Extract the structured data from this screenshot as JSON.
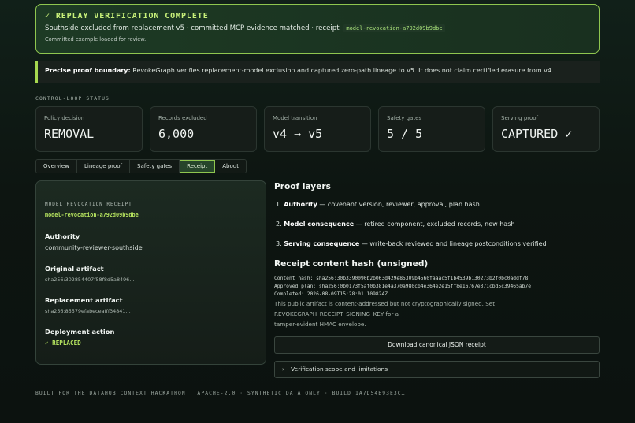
{
  "banner": {
    "title": "✓ REPLAY VERIFICATION COMPLETE",
    "subtitle": "Southside excluded from replacement v5 · committed MCP evidence matched · receipt",
    "receipt_id": "model-revocation-a792d09b9dbe",
    "note": "Committed example loaded for review."
  },
  "boundary": {
    "label": "Precise proof boundary:",
    "text": "RevokeGraph verifies replacement-model exclusion and captured zero-path lineage to v5. It does not claim certified erasure from v4."
  },
  "control_loop": {
    "label": "CONTROL-LOOP STATUS",
    "metrics": [
      {
        "label": "Policy decision",
        "value": "REMOVAL"
      },
      {
        "label": "Records excluded",
        "value": "6,000"
      },
      {
        "label": "Model transition",
        "value": "v4 → v5"
      },
      {
        "label": "Safety gates",
        "value": "5 / 5"
      },
      {
        "label": "Serving proof",
        "value": "CAPTURED ✓"
      }
    ]
  },
  "tabs": [
    "Overview",
    "Lineage proof",
    "Safety gates",
    "Receipt",
    "About"
  ],
  "active_tab": "Receipt",
  "receipt": {
    "label": "MODEL REVOCATION RECEIPT",
    "id": "model-revocation-a792d09b9dbe",
    "fields": [
      {
        "label": "Authority",
        "value": "community-reviewer-southside"
      },
      {
        "label": "Original artifact",
        "value": "sha256:302854407f58f8d5a8496…"
      },
      {
        "label": "Replacement artifact",
        "value": "sha256:85579efabeceafff34841…"
      },
      {
        "label": "Deployment action",
        "value": "✓ REPLACED"
      }
    ]
  },
  "proof_layers": {
    "title": "Proof layers",
    "items": [
      {
        "num": "1.",
        "name": "Authority",
        "desc": "— covenant version, reviewer, approval, plan hash"
      },
      {
        "num": "2.",
        "name": "Model consequence",
        "desc": "— retired component, excluded records, new hash"
      },
      {
        "num": "3.",
        "name": "Serving consequence",
        "desc": "— write-back reviewed and lineage postconditions verified"
      }
    ]
  },
  "content_hash": {
    "title": "Receipt content hash (unsigned)",
    "lines": [
      "Content hash: sha256:30b3390090b2b063d429e85309b4560faaac5f1b4539b130273b2f0bc0addf78",
      "Approved plan: sha256:0b0173f5af0b381e4a370a980cb4e364e2e15ff8e16767e371cbd5c39465ab7e",
      "Completed: 2026-08-09T15:28:01.109824Z"
    ],
    "note_1": "This public artifact is content-addressed but not cryptographically signed. Set REVOKEGRAPH_RECEIPT_SIGNING_KEY for a",
    "note_2": "tamper-evident HMAC envelope."
  },
  "download_label": "Download canonical JSON receipt",
  "details_label": "Verification scope and limitations",
  "footer": "BUILT FOR THE DATAHUB CONTEXT HACKATHON · APACHE-2.0 · SYNTHETIC DATA ONLY · BUILD 1A7D54E93E3C…",
  "colors": {
    "accent": "#b6e45f",
    "banner_border": "#8fc64f",
    "background": "#0d1511"
  }
}
